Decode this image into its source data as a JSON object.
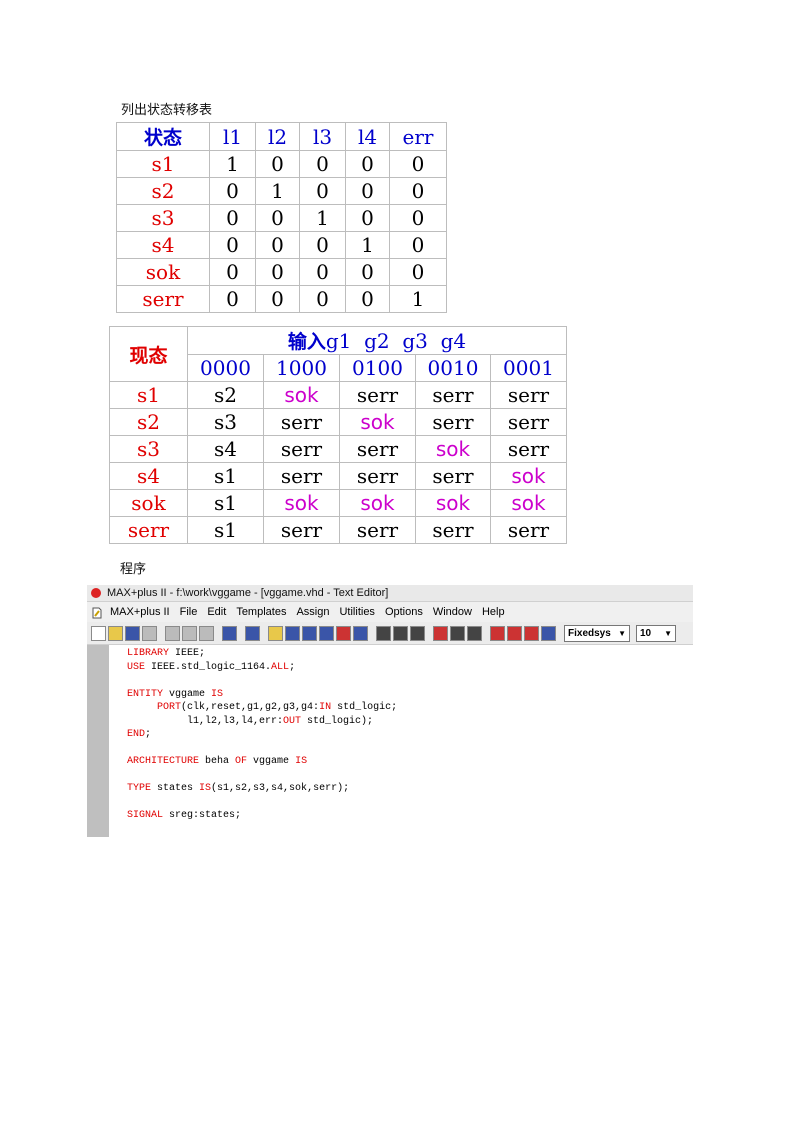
{
  "caption1": "列出状态转移表",
  "table1": {
    "headers": [
      "状态",
      "l1",
      "l2",
      "l3",
      "l4",
      "err"
    ],
    "rows": [
      {
        "state": "s1",
        "vals": [
          "1",
          "0",
          "0",
          "0",
          "0"
        ]
      },
      {
        "state": "s2",
        "vals": [
          "0",
          "1",
          "0",
          "0",
          "0"
        ]
      },
      {
        "state": "s3",
        "vals": [
          "0",
          "0",
          "1",
          "0",
          "0"
        ]
      },
      {
        "state": "s4",
        "vals": [
          "0",
          "0",
          "0",
          "1",
          "0"
        ]
      },
      {
        "state": "sok",
        "vals": [
          "0",
          "0",
          "0",
          "0",
          "0"
        ]
      },
      {
        "state": "serr",
        "vals": [
          "0",
          "0",
          "0",
          "0",
          "1"
        ]
      }
    ]
  },
  "table2": {
    "current_state_header": "现态",
    "input_header_cn": "输入",
    "input_header_vars": "g1  g2  g3  g4",
    "codes": [
      "0000",
      "1000",
      "0100",
      "0010",
      "0001"
    ],
    "rows": [
      {
        "state": "s1",
        "next": [
          "s2",
          "sok",
          "serr",
          "serr",
          "serr"
        ]
      },
      {
        "state": "s2",
        "next": [
          "s3",
          "serr",
          "sok",
          "serr",
          "serr"
        ]
      },
      {
        "state": "s3",
        "next": [
          "s4",
          "serr",
          "serr",
          "sok",
          "serr"
        ]
      },
      {
        "state": "s4",
        "next": [
          "s1",
          "serr",
          "serr",
          "serr",
          "sok"
        ]
      },
      {
        "state": "sok",
        "next": [
          "s1",
          "sok",
          "sok",
          "sok",
          "sok"
        ]
      },
      {
        "state": "serr",
        "next": [
          "s1",
          "serr",
          "serr",
          "serr",
          "serr"
        ]
      }
    ]
  },
  "caption2": "程序",
  "editor": {
    "title": "MAX+plus II - f:\\work\\vggame - [vggame.vhd - Text Editor]",
    "menus": [
      "MAX+plus II",
      "File",
      "Edit",
      "Templates",
      "Assign",
      "Utilities",
      "Options",
      "Window",
      "Help"
    ],
    "font_select": "Fixedsys",
    "size_select": "10",
    "code": [
      [
        {
          "k": "LIBRARY"
        },
        {
          "t": " IEEE;"
        }
      ],
      [
        {
          "k": "USE"
        },
        {
          "t": " IEEE.std_logic_1164."
        },
        {
          "k": "ALL"
        },
        {
          "t": ";"
        }
      ],
      [],
      [
        {
          "k": "ENTITY"
        },
        {
          "t": " vggame "
        },
        {
          "k": "IS"
        }
      ],
      [
        {
          "t": "     "
        },
        {
          "k": "PORT"
        },
        {
          "t": "(clk,reset,g1,g2,g3,g4:"
        },
        {
          "k": "IN"
        },
        {
          "t": " std_logic;"
        }
      ],
      [
        {
          "t": "          l1,l2,l3,l4,err:"
        },
        {
          "k": "OUT"
        },
        {
          "t": " std_logic);"
        }
      ],
      [
        {
          "k": "END"
        },
        {
          "t": ";"
        }
      ],
      [],
      [
        {
          "k": "ARCHITECTURE"
        },
        {
          "t": " beha "
        },
        {
          "k": "OF"
        },
        {
          "t": " vggame "
        },
        {
          "k": "IS"
        }
      ],
      [],
      [
        {
          "k": "TYPE"
        },
        {
          "t": " states "
        },
        {
          "k": "IS"
        },
        {
          "t": "(s1,s2,s3,s4,sok,serr);"
        }
      ],
      [],
      [
        {
          "k": "SIGNAL"
        },
        {
          "t": " sreg:states;"
        }
      ]
    ]
  }
}
